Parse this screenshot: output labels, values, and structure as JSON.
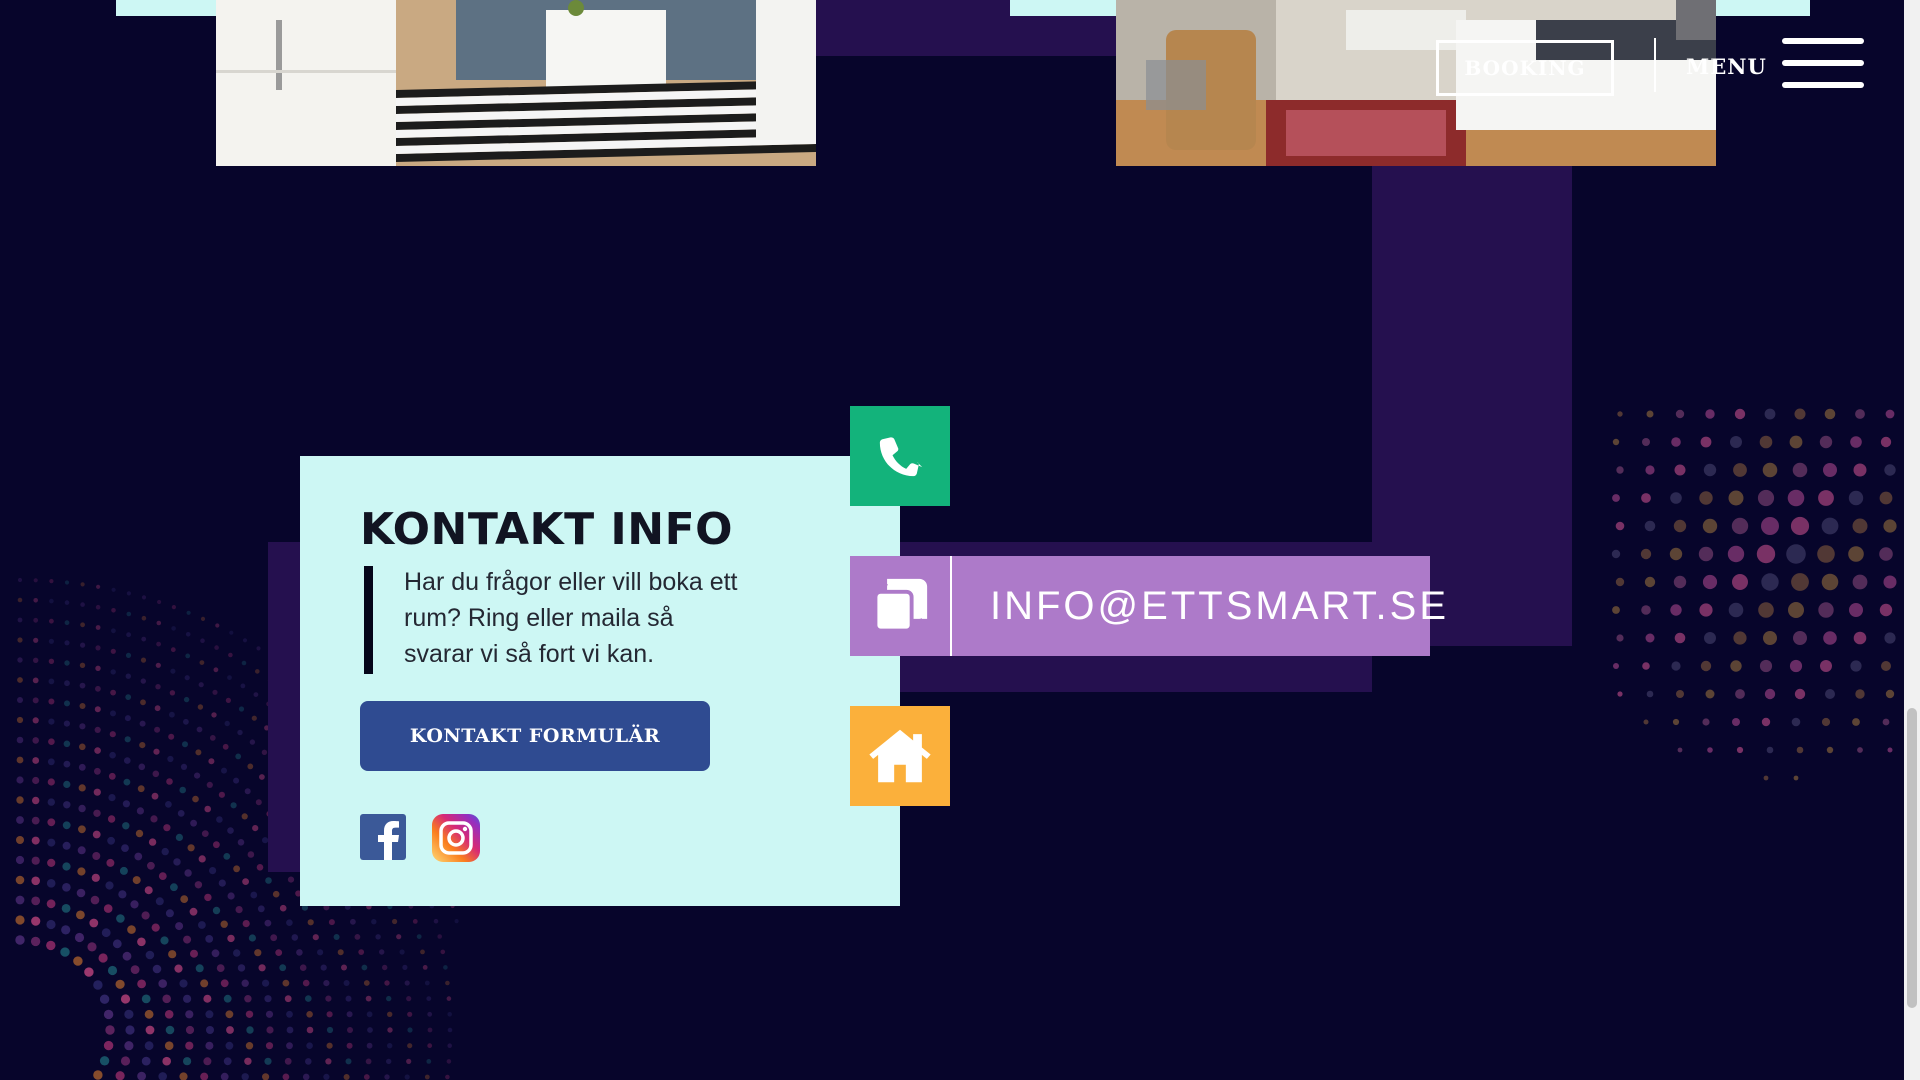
{
  "header": {
    "book_label": "BOOKING",
    "menu_label": "MENU"
  },
  "contact": {
    "title": "KONTAKT INFO",
    "description": "Har du frågor eller vill boka ett rum? Ring eller maila så svarar vi så fort vi kan.",
    "form_button_label": "KONTAKT FORMULÄR",
    "email": "INFO@ETTSMART.SE"
  },
  "icons": {
    "phone": "phone-icon",
    "email": "copy-icon",
    "address": "home-icon",
    "facebook": "facebook-icon",
    "instagram": "instagram-icon"
  },
  "colors": {
    "background": "#07052b",
    "card": "#cdf7f4",
    "phone_tile": "#13b37b",
    "email_bar": "#ad7ac9",
    "home_tile": "#fbb03b",
    "form_button": "#2f4b91",
    "deco_purple": "#25104f"
  }
}
